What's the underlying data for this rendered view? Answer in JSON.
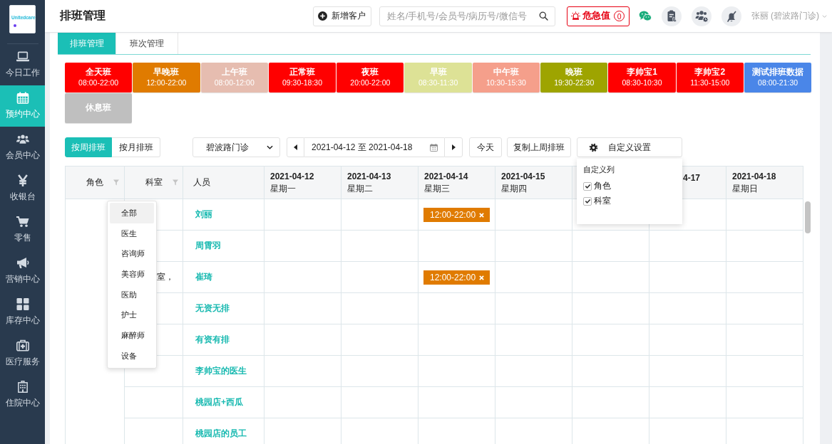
{
  "sidebar": {
    "logo": "Unitedcare",
    "items": [
      {
        "label": "今日工作",
        "selected": false
      },
      {
        "label": "预约中心",
        "selected": true
      },
      {
        "label": "会员中心",
        "selected": false
      },
      {
        "label": "收银台",
        "selected": false
      },
      {
        "label": "零售",
        "selected": false
      },
      {
        "label": "营销中心",
        "selected": false
      },
      {
        "label": "库存中心",
        "selected": false
      },
      {
        "label": "医疗服务",
        "selected": false
      },
      {
        "label": "住院中心",
        "selected": false
      }
    ]
  },
  "top_bar": {
    "title": "排班管理",
    "add_button": "新增客户",
    "search": {
      "placeholder": "姓名/手机号/会员号/病历号/微信号"
    },
    "alert": {
      "label": "危急值",
      "count": "0"
    },
    "user": "张丽 (碧波路门诊)"
  },
  "tabs": [
    {
      "label": "排班管理",
      "selected": true
    },
    {
      "label": "班次管理",
      "selected": false
    }
  ],
  "shifts": [
    {
      "name": "全天班",
      "time": "08:00-22:00",
      "color": "#ff0000"
    },
    {
      "name": "早晚班",
      "time": "12:00-22:00",
      "color": "#e07b00"
    },
    {
      "name": "上午班",
      "time": "08:00-12:00",
      "color": "#e6bdb0"
    },
    {
      "name": "正常班",
      "time": "09:30-18:30",
      "color": "#ff0000"
    },
    {
      "name": "夜班",
      "time": "20:00-22:00",
      "color": "#ff0000"
    },
    {
      "name": "早班",
      "time": "08:30-11:30",
      "color": "#dde296"
    },
    {
      "name": "中午班",
      "time": "10:30-15:30",
      "color": "#f59f8b"
    },
    {
      "name": "晚班",
      "time": "19:30-22:30",
      "color": "#9ea400"
    },
    {
      "name": "李帅宝1",
      "time": "08:30-10:30",
      "color": "#ff0000"
    },
    {
      "name": "李帅宝2",
      "time": "11:30-15:00",
      "color": "#ff0000"
    },
    {
      "name": "测试排班数据",
      "time": "08:00-21:30",
      "color": "#4a86e8"
    },
    {
      "name": "休息班",
      "color": "#bfbfbf"
    }
  ],
  "toolbar": {
    "view_toggle": [
      {
        "label": "按周排班",
        "selected": true
      },
      {
        "label": "按月排班",
        "selected": false
      }
    ],
    "clinic_select": "碧波路门诊",
    "date_range": "2021-04-12 至 2021-04-18",
    "today_button": "今天",
    "copy_button": "复制上周排班",
    "settings_button": "自定义设置",
    "settings_panel": {
      "title": "自定义列",
      "options": [
        {
          "label": "角色",
          "checked": true
        },
        {
          "label": "科室",
          "checked": true
        }
      ]
    }
  },
  "table": {
    "columns": [
      {
        "label": "角色",
        "filter": true
      },
      {
        "label": "科室",
        "filter": true
      },
      {
        "label": "人员",
        "filter": false
      }
    ],
    "days": [
      {
        "kind": "full",
        "date": "2021-04-12",
        "weekday": "星期一"
      },
      {
        "kind": "full",
        "date": "2021-04-13",
        "weekday": "星期二"
      },
      {
        "kind": "full",
        "date": "2021-04-14",
        "weekday": "星期三"
      },
      {
        "kind": "full",
        "date": "2021-04-15",
        "weekday": "星期四"
      },
      {
        "kind": "covered"
      },
      {
        "kind": "partial",
        "date": "4-17"
      },
      {
        "kind": "full",
        "date": "2021-04-18",
        "weekday": "星期日"
      }
    ],
    "role_filter": {
      "options": [
        {
          "label": "全部",
          "selected": true
        },
        {
          "label": "医生",
          "selected": false
        },
        {
          "label": "咨询师",
          "selected": false
        },
        {
          "label": "美容师",
          "selected": false
        },
        {
          "label": "医助",
          "selected": false
        },
        {
          "label": "护士",
          "selected": false
        },
        {
          "label": "麻醉师",
          "selected": false
        },
        {
          "label": "设备",
          "selected": false
        }
      ]
    },
    "rows": [
      {
        "name": "刘丽",
        "cells": [
          null,
          null,
          {
            "time": "12:00-22:00",
            "color": "#e07b00"
          },
          null,
          null,
          null,
          null
        ]
      },
      {
        "name": "周霄羽",
        "cells": [
          null,
          null,
          null,
          null,
          null,
          null,
          null
        ]
      },
      {
        "name": "崔琦",
        "department": "室，",
        "cells": [
          null,
          null,
          {
            "time": "12:00-22:00",
            "color": "#e07b00"
          },
          null,
          null,
          null,
          null
        ]
      },
      {
        "name": "无资无排",
        "cells": [
          null,
          null,
          null,
          null,
          null,
          null,
          null
        ]
      },
      {
        "name": "有资有排",
        "cells": [
          null,
          null,
          null,
          null,
          null,
          null,
          null
        ]
      },
      {
        "name": "李帅宝的医生",
        "cells": [
          null,
          null,
          null,
          null,
          null,
          null,
          null
        ]
      },
      {
        "name": "桃园店+西瓜",
        "cells": [
          null,
          null,
          null,
          null,
          null,
          null,
          null
        ]
      },
      {
        "name": "桃园店的员工",
        "cells": [
          null,
          null,
          null,
          null,
          null,
          null,
          null
        ]
      }
    ]
  }
}
